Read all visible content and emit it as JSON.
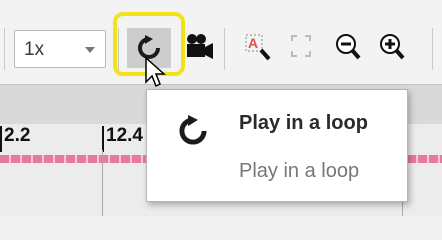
{
  "toolbar": {
    "speed_select": {
      "value": "1x"
    },
    "loop_button": {
      "icon": "loop-icon",
      "highlight_color": "#f1e21a",
      "active": true
    },
    "buttons": [
      {
        "name": "camera",
        "icon": "video-camera-icon"
      },
      {
        "name": "zoom-text",
        "icon": "zoom-text-icon"
      },
      {
        "name": "fit",
        "icon": "fit-to-window-icon",
        "disabled": true
      },
      {
        "name": "zoom-out",
        "icon": "zoom-out-icon"
      },
      {
        "name": "zoom-in",
        "icon": "zoom-in-icon"
      }
    ]
  },
  "timeline": {
    "ticks": [
      "2.2",
      "12.4"
    ],
    "track_color": "#e67a9a"
  },
  "tooltip": {
    "icon": "loop-icon",
    "title": "Play in a loop",
    "description": "Play in a loop"
  }
}
